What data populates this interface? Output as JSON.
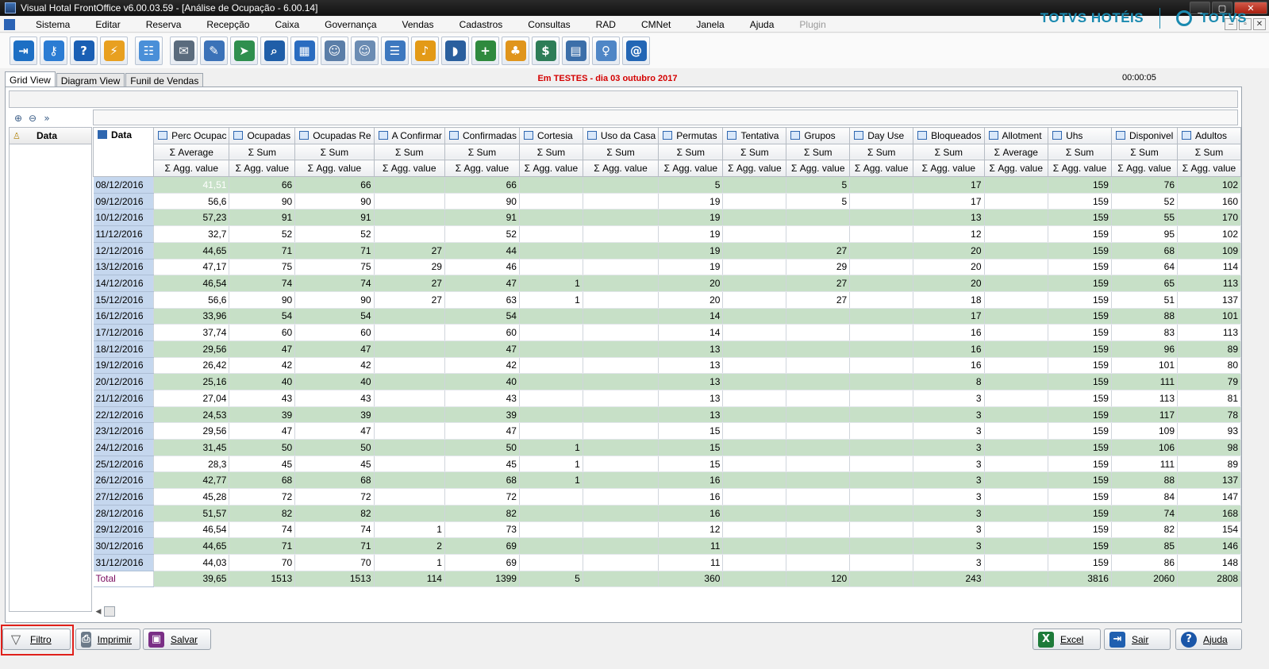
{
  "window": {
    "title": "Visual Hotal FrontOffice v6.00.03.59 - [Análise de Ocupação - 6.00.14]",
    "controls": [
      "_",
      "▢",
      "✕"
    ]
  },
  "menu": [
    "Sistema",
    "Editar",
    "Reserva",
    "Recepção",
    "Caixa",
    "Governança",
    "Vendas",
    "Cadastros",
    "Consultas",
    "RAD",
    "CMNet",
    "Janela",
    "Ajuda"
  ],
  "menu_disabled": "Plugin",
  "mdi_controls": [
    "–",
    "▫",
    "✕"
  ],
  "toolbar_icons": [
    {
      "name": "exit-icon",
      "glyph": "⇥",
      "color": "#1d6fc4"
    },
    {
      "name": "user-key-icon",
      "glyph": "⚷",
      "color": "#2b7cd3"
    },
    {
      "name": "help-icon",
      "glyph": "?",
      "color": "#1a5fb4"
    },
    {
      "name": "lightning-icon",
      "glyph": "⚡",
      "color": "#e8a020"
    },
    {
      "name": "diagram-icon",
      "glyph": "☷",
      "color": "#4a8fd8"
    },
    {
      "name": "mail-icon",
      "glyph": "✉",
      "color": "#5a6b7d"
    },
    {
      "name": "form-edit-icon",
      "glyph": "✎",
      "color": "#3b72b8"
    },
    {
      "name": "mail-send-icon",
      "glyph": "➤",
      "color": "#2f8f4e"
    },
    {
      "name": "search-icon",
      "glyph": "⌕",
      "color": "#1f5ea8"
    },
    {
      "name": "calendar-icon",
      "glyph": "▦",
      "color": "#2a6cc0"
    },
    {
      "name": "guest-card-icon",
      "glyph": "☺",
      "color": "#5b7ea8"
    },
    {
      "name": "guest-card-2-icon",
      "glyph": "☺",
      "color": "#6b8cb3"
    },
    {
      "name": "person-list-icon",
      "glyph": "☰",
      "color": "#3d78bf"
    },
    {
      "name": "bell-icon",
      "glyph": "♪",
      "color": "#e39a17"
    },
    {
      "name": "footsteps-icon",
      "glyph": "◗",
      "color": "#2a5f9e"
    },
    {
      "name": "add-user-icon",
      "glyph": "+",
      "color": "#2f8a3e"
    },
    {
      "name": "group-icon",
      "glyph": "♣",
      "color": "#e0951c"
    },
    {
      "name": "payment-window-icon",
      "glyph": "$",
      "color": "#2e7d57"
    },
    {
      "name": "cash-register-icon",
      "glyph": "▤",
      "color": "#3c6fa9"
    },
    {
      "name": "housekeeper-icon",
      "glyph": "♀",
      "color": "#4f86c6"
    },
    {
      "name": "email-at-icon",
      "glyph": "@",
      "color": "#2366b5"
    }
  ],
  "brand": {
    "left": "TOTVS HOTÉIS",
    "right": "TOTVS",
    "color": "#1a8ab0"
  },
  "tabs": [
    "Grid View",
    "Diagram View",
    "Funil de Vendas"
  ],
  "status_message": "Em TESTES - dia 03 outubro 2017",
  "timer": "00:00:05",
  "row_field": "Data",
  "data_header": "Data",
  "columns": [
    {
      "name": "Perc Ocupac",
      "agg": "Average"
    },
    {
      "name": "Ocupadas",
      "agg": "Sum"
    },
    {
      "name": "Ocupadas Re",
      "agg": "Sum"
    },
    {
      "name": "A Confirmar",
      "agg": "Sum"
    },
    {
      "name": "Confirmadas",
      "agg": "Sum"
    },
    {
      "name": "Cortesia",
      "agg": "Sum"
    },
    {
      "name": "Uso da Casa",
      "agg": "Sum"
    },
    {
      "name": "Permutas",
      "agg": "Sum"
    },
    {
      "name": "Tentativa",
      "agg": "Sum"
    },
    {
      "name": "Grupos",
      "agg": "Sum"
    },
    {
      "name": "Day Use",
      "agg": "Sum"
    },
    {
      "name": "Bloqueados",
      "agg": "Sum"
    },
    {
      "name": "Allotment",
      "agg": "Average"
    },
    {
      "name": "Uhs",
      "agg": "Sum"
    },
    {
      "name": "Disponivel",
      "agg": "Sum"
    },
    {
      "name": "Adultos",
      "agg": "Sum"
    }
  ],
  "agg_value_label": "Agg. value",
  "rows": [
    {
      "date": "08/12/2016",
      "cells": [
        "41,51",
        "66",
        "66",
        "",
        "66",
        "",
        "",
        "5",
        "",
        "5",
        "",
        "17",
        "",
        "159",
        "76",
        "102"
      ]
    },
    {
      "date": "09/12/2016",
      "cells": [
        "56,6",
        "90",
        "90",
        "",
        "90",
        "",
        "",
        "19",
        "",
        "5",
        "",
        "17",
        "",
        "159",
        "52",
        "160"
      ]
    },
    {
      "date": "10/12/2016",
      "cells": [
        "57,23",
        "91",
        "91",
        "",
        "91",
        "",
        "",
        "19",
        "",
        "",
        "",
        "13",
        "",
        "159",
        "55",
        "170"
      ]
    },
    {
      "date": "11/12/2016",
      "cells": [
        "32,7",
        "52",
        "52",
        "",
        "52",
        "",
        "",
        "19",
        "",
        "",
        "",
        "12",
        "",
        "159",
        "95",
        "102"
      ]
    },
    {
      "date": "12/12/2016",
      "cells": [
        "44,65",
        "71",
        "71",
        "27",
        "44",
        "",
        "",
        "19",
        "",
        "27",
        "",
        "20",
        "",
        "159",
        "68",
        "109"
      ]
    },
    {
      "date": "13/12/2016",
      "cells": [
        "47,17",
        "75",
        "75",
        "29",
        "46",
        "",
        "",
        "19",
        "",
        "29",
        "",
        "20",
        "",
        "159",
        "64",
        "114"
      ]
    },
    {
      "date": "14/12/2016",
      "cells": [
        "46,54",
        "74",
        "74",
        "27",
        "47",
        "1",
        "",
        "20",
        "",
        "27",
        "",
        "20",
        "",
        "159",
        "65",
        "113"
      ]
    },
    {
      "date": "15/12/2016",
      "cells": [
        "56,6",
        "90",
        "90",
        "27",
        "63",
        "1",
        "",
        "20",
        "",
        "27",
        "",
        "18",
        "",
        "159",
        "51",
        "137"
      ]
    },
    {
      "date": "16/12/2016",
      "cells": [
        "33,96",
        "54",
        "54",
        "",
        "54",
        "",
        "",
        "14",
        "",
        "",
        "",
        "17",
        "",
        "159",
        "88",
        "101"
      ]
    },
    {
      "date": "17/12/2016",
      "cells": [
        "37,74",
        "60",
        "60",
        "",
        "60",
        "",
        "",
        "14",
        "",
        "",
        "",
        "16",
        "",
        "159",
        "83",
        "113"
      ]
    },
    {
      "date": "18/12/2016",
      "cells": [
        "29,56",
        "47",
        "47",
        "",
        "47",
        "",
        "",
        "13",
        "",
        "",
        "",
        "16",
        "",
        "159",
        "96",
        "89"
      ]
    },
    {
      "date": "19/12/2016",
      "cells": [
        "26,42",
        "42",
        "42",
        "",
        "42",
        "",
        "",
        "13",
        "",
        "",
        "",
        "16",
        "",
        "159",
        "101",
        "80"
      ]
    },
    {
      "date": "20/12/2016",
      "cells": [
        "25,16",
        "40",
        "40",
        "",
        "40",
        "",
        "",
        "13",
        "",
        "",
        "",
        "8",
        "",
        "159",
        "111",
        "79"
      ]
    },
    {
      "date": "21/12/2016",
      "cells": [
        "27,04",
        "43",
        "43",
        "",
        "43",
        "",
        "",
        "13",
        "",
        "",
        "",
        "3",
        "",
        "159",
        "113",
        "81"
      ]
    },
    {
      "date": "22/12/2016",
      "cells": [
        "24,53",
        "39",
        "39",
        "",
        "39",
        "",
        "",
        "13",
        "",
        "",
        "",
        "3",
        "",
        "159",
        "117",
        "78"
      ]
    },
    {
      "date": "23/12/2016",
      "cells": [
        "29,56",
        "47",
        "47",
        "",
        "47",
        "",
        "",
        "15",
        "",
        "",
        "",
        "3",
        "",
        "159",
        "109",
        "93"
      ]
    },
    {
      "date": "24/12/2016",
      "cells": [
        "31,45",
        "50",
        "50",
        "",
        "50",
        "1",
        "",
        "15",
        "",
        "",
        "",
        "3",
        "",
        "159",
        "106",
        "98"
      ]
    },
    {
      "date": "25/12/2016",
      "cells": [
        "28,3",
        "45",
        "45",
        "",
        "45",
        "1",
        "",
        "15",
        "",
        "",
        "",
        "3",
        "",
        "159",
        "111",
        "89"
      ]
    },
    {
      "date": "26/12/2016",
      "cells": [
        "42,77",
        "68",
        "68",
        "",
        "68",
        "1",
        "",
        "16",
        "",
        "",
        "",
        "3",
        "",
        "159",
        "88",
        "137"
      ]
    },
    {
      "date": "27/12/2016",
      "cells": [
        "45,28",
        "72",
        "72",
        "",
        "72",
        "",
        "",
        "16",
        "",
        "",
        "",
        "3",
        "",
        "159",
        "84",
        "147"
      ]
    },
    {
      "date": "28/12/2016",
      "cells": [
        "51,57",
        "82",
        "82",
        "",
        "82",
        "",
        "",
        "16",
        "",
        "",
        "",
        "3",
        "",
        "159",
        "74",
        "168"
      ]
    },
    {
      "date": "29/12/2016",
      "cells": [
        "46,54",
        "74",
        "74",
        "1",
        "73",
        "",
        "",
        "12",
        "",
        "",
        "",
        "3",
        "",
        "159",
        "82",
        "154"
      ]
    },
    {
      "date": "30/12/2016",
      "cells": [
        "44,65",
        "71",
        "71",
        "2",
        "69",
        "",
        "",
        "11",
        "",
        "",
        "",
        "3",
        "",
        "159",
        "85",
        "146"
      ]
    },
    {
      "date": "31/12/2016",
      "cells": [
        "44,03",
        "70",
        "70",
        "1",
        "69",
        "",
        "",
        "11",
        "",
        "",
        "",
        "3",
        "",
        "159",
        "86",
        "148"
      ]
    }
  ],
  "total": {
    "label": "Total",
    "cells": [
      "39,65",
      "1513",
      "1513",
      "114",
      "1399",
      "5",
      "",
      "360",
      "",
      "120",
      "",
      "243",
      "",
      "3816",
      "2060",
      "2808"
    ]
  },
  "bottom_buttons": {
    "filtro": "Filtro",
    "imprimir": "Imprimir",
    "salvar": "Salvar",
    "excel": "Excel",
    "sair": "Sair",
    "ajuda": "Ajuda"
  }
}
